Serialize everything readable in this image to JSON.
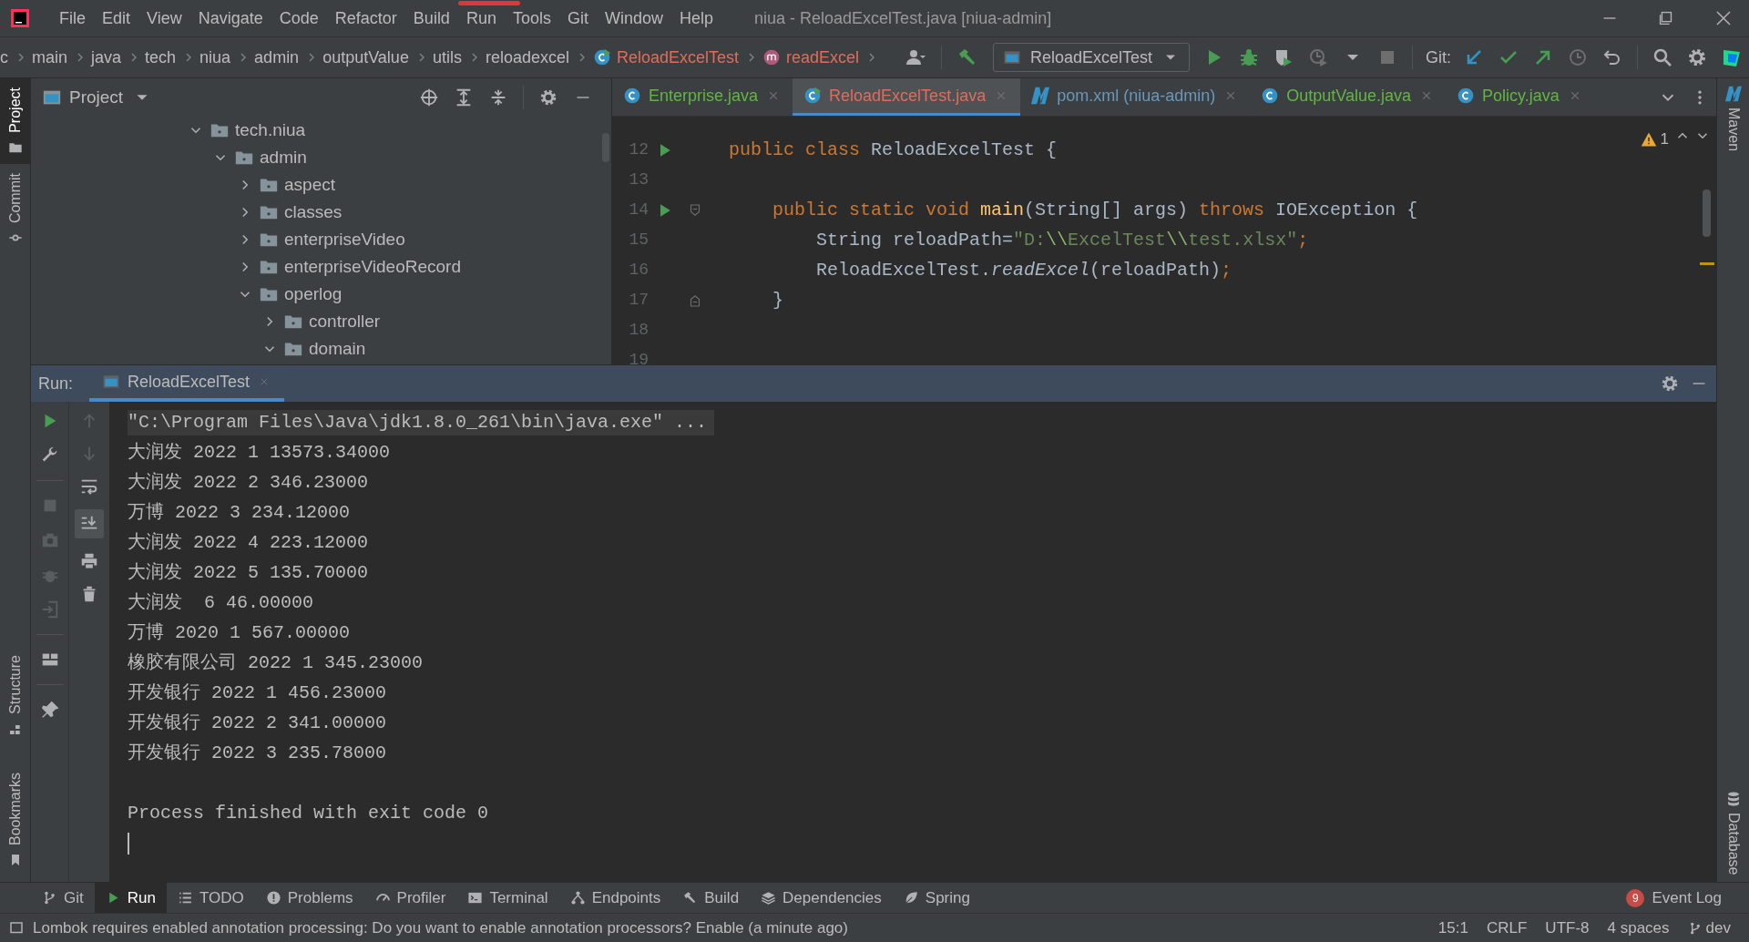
{
  "window": {
    "title": "niua - ReloadExcelTest.java [niua-admin]"
  },
  "menu": [
    "File",
    "Edit",
    "View",
    "Navigate",
    "Code",
    "Refactor",
    "Build",
    "Run",
    "Tools",
    "Git",
    "Window",
    "Help"
  ],
  "breadcrumbs": [
    {
      "label": "c",
      "kind": "folder"
    },
    {
      "label": "main",
      "kind": "folder"
    },
    {
      "label": "java",
      "kind": "folder"
    },
    {
      "label": "tech",
      "kind": "folder"
    },
    {
      "label": "niua",
      "kind": "folder"
    },
    {
      "label": "admin",
      "kind": "folder"
    },
    {
      "label": "outputValue",
      "kind": "folder"
    },
    {
      "label": "utils",
      "kind": "folder"
    },
    {
      "label": "reloadexcel",
      "kind": "folder"
    },
    {
      "label": "ReloadExcelTest",
      "kind": "class"
    },
    {
      "label": "readExcel",
      "kind": "method"
    }
  ],
  "run_configuration": "ReloadExcelTest",
  "git_label": "Git:",
  "left_stripe": [
    {
      "label": "Project",
      "selected": true
    },
    {
      "label": "Commit",
      "selected": false
    }
  ],
  "left_stripe_bottom": [
    {
      "label": "Structure",
      "selected": false
    },
    {
      "label": "Bookmarks",
      "selected": false
    }
  ],
  "right_stripe": [
    "Maven",
    "Database"
  ],
  "project_panel": {
    "title": "Project",
    "tree": [
      {
        "label": "tech.niua",
        "expanded": true,
        "children": [
          {
            "label": "admin",
            "expanded": true,
            "children": [
              {
                "label": "aspect",
                "expanded": false
              },
              {
                "label": "classes",
                "expanded": false
              },
              {
                "label": "enterpriseVideo",
                "expanded": false
              },
              {
                "label": "enterpriseVideoRecord",
                "expanded": false
              },
              {
                "label": "operlog",
                "expanded": true,
                "children": [
                  {
                    "label": "controller",
                    "expanded": false
                  },
                  {
                    "label": "domain",
                    "expanded": true
                  }
                ]
              }
            ]
          }
        ]
      }
    ]
  },
  "editor_tabs": [
    {
      "label": "Enterprise.java",
      "kind": "class",
      "color": "#62b543",
      "selected": false
    },
    {
      "label": "ReloadExcelTest.java",
      "kind": "runnable",
      "color": "#e06c5c",
      "selected": true
    },
    {
      "label": "pom.xml (niua-admin)",
      "kind": "maven",
      "color": "#6897bb",
      "selected": false
    },
    {
      "label": "OutputValue.java",
      "kind": "class",
      "color": "#62b543",
      "selected": false
    },
    {
      "label": "Policy.java",
      "kind": "class",
      "color": "#62b543",
      "selected": false
    }
  ],
  "warnings": "1",
  "code": [
    {
      "number": "12",
      "runnable": true,
      "tokens": [
        {
          "kind": "keyword",
          "text": "public class "
        },
        {
          "kind": "plain",
          "text": "ReloadExcelTest {"
        }
      ]
    },
    {
      "number": "13"
    },
    {
      "number": "14",
      "runnable": true,
      "fold": true,
      "tokens": [
        {
          "kind": "keyword",
          "text": "    public static void "
        },
        {
          "kind": "method",
          "text": "main"
        },
        {
          "kind": "plain",
          "text": "(String[] args) "
        },
        {
          "kind": "keyword",
          "text": "throws "
        },
        {
          "kind": "plain",
          "text": "IOException {"
        }
      ]
    },
    {
      "number": "15",
      "tokens": [
        {
          "kind": "plain",
          "text": "        String reloadPath="
        },
        {
          "kind": "string",
          "text": "\"D:"
        },
        {
          "kind": "escape",
          "text": "\\\\"
        },
        {
          "kind": "string",
          "text": "ExcelTest"
        },
        {
          "kind": "escape",
          "text": "\\\\"
        },
        {
          "kind": "string",
          "text": "test.xlsx\""
        },
        {
          "kind": "keyword",
          "text": ";"
        }
      ]
    },
    {
      "number": "16",
      "tokens": [
        {
          "kind": "plain",
          "text": "        ReloadExcelTest."
        },
        {
          "kind": "italic",
          "text": "readExcel"
        },
        {
          "kind": "plain",
          "text": "(reloadPath)"
        },
        {
          "kind": "keyword",
          "text": ";"
        }
      ]
    },
    {
      "number": "17",
      "fold": true,
      "tokens": [
        {
          "kind": "plain",
          "text": "    }"
        }
      ]
    },
    {
      "number": "18"
    },
    {
      "number": "19"
    }
  ],
  "run_panel": {
    "label": "Run:",
    "tabs": [
      {
        "label": "ReloadExcelTest",
        "selected": true
      }
    ],
    "console": [
      {
        "kind": "command",
        "text": "\"C:\\Program Files\\Java\\jdk1.8.0_261\\bin\\java.exe\" ..."
      },
      {
        "kind": "output",
        "text": "大润发 2022 1 13573.34000"
      },
      {
        "kind": "output",
        "text": "大润发 2022 2 346.23000"
      },
      {
        "kind": "output",
        "text": "万博 2022 3 234.12000"
      },
      {
        "kind": "output",
        "text": "大润发 2022 4 223.12000"
      },
      {
        "kind": "output",
        "text": "大润发 2022 5 135.70000"
      },
      {
        "kind": "output",
        "text": "大润发  6 46.00000"
      },
      {
        "kind": "output",
        "text": "万博 2020 1 567.00000"
      },
      {
        "kind": "output",
        "text": "橡胶有限公司 2022 1 345.23000"
      },
      {
        "kind": "output",
        "text": "开发银行 2022 1 456.23000"
      },
      {
        "kind": "output",
        "text": "开发银行 2022 2 341.00000"
      },
      {
        "kind": "output",
        "text": "开发银行 2022 3 235.78000"
      },
      {
        "kind": "blank"
      },
      {
        "kind": "output",
        "text": "Process finished with exit code 0"
      }
    ]
  },
  "tool_windows": [
    {
      "label": "Git",
      "selected": false
    },
    {
      "label": "Run",
      "selected": true
    },
    {
      "label": "TODO",
      "selected": false
    },
    {
      "label": "Problems",
      "selected": false
    },
    {
      "label": "Profiler",
      "selected": false
    },
    {
      "label": "Terminal",
      "selected": false
    },
    {
      "label": "Endpoints",
      "selected": false
    },
    {
      "label": "Build",
      "selected": false
    },
    {
      "label": "Dependencies",
      "selected": false
    },
    {
      "label": "Spring",
      "selected": false
    }
  ],
  "event_log": {
    "label": "Event Log",
    "count": "9"
  },
  "status_bar": {
    "message": "Lombok requires enabled annotation processing: Do you want to enable annotation processors? Enable (a minute ago)",
    "items": [
      "15:1",
      "CRLF",
      "UTF-8",
      "4 spaces"
    ],
    "branch": "dev"
  }
}
